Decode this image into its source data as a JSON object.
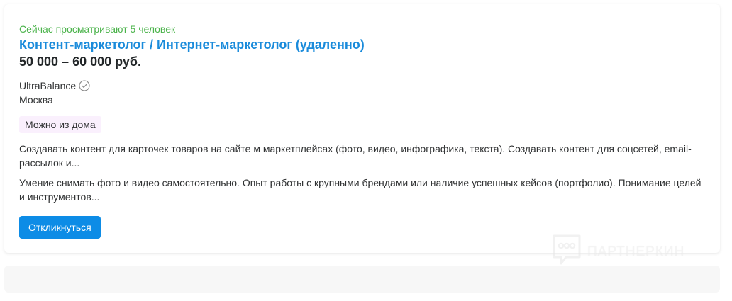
{
  "vacancy": {
    "viewers": "Сейчас просматривают 5 человек",
    "title": "Контент-маркетолог / Интернет-маркетолог (удаленно)",
    "salary": "50 000 – 60 000 руб.",
    "company": "UltraBalance",
    "city": "Москва",
    "tag": "Можно из дома",
    "responsibilities": "Создавать контент для карточек товаров на сайте м маркетплейсах (фото, видео, инфографика, текста). Создавать контент для соцсетей, email-рассылок и...",
    "requirements": "Умение снимать фото и видео самостоятельно. Опыт работы с крупными брендами или наличие успешных кейсов (портфолио). Понимание целей и инструментов...",
    "apply_label": "Откликнуться"
  },
  "watermark": {
    "text": "ПАРТНЕРКИН"
  },
  "colors": {
    "viewers": "#4bb34b",
    "title": "#1a8bdb",
    "button": "#0d8ce6",
    "tag_bg": "#faf0fd"
  }
}
